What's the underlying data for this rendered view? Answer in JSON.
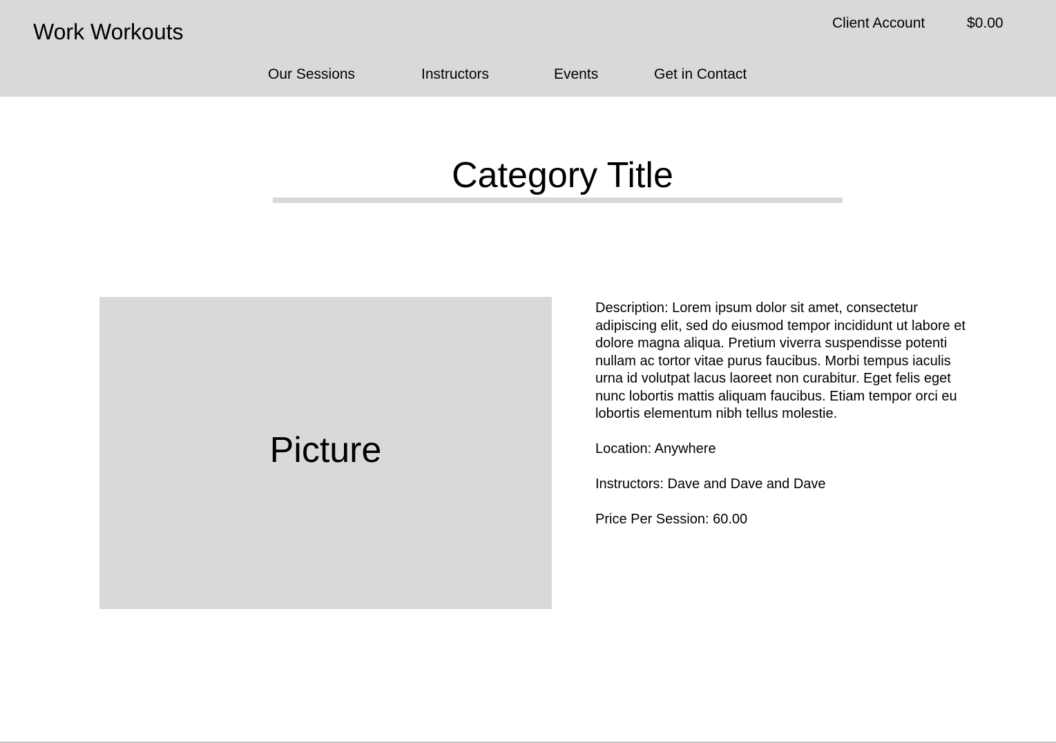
{
  "header": {
    "brand": "Work Workouts",
    "account_label": "Client Account",
    "cart_total": "$0.00",
    "nav": [
      {
        "label": "Our Sessions"
      },
      {
        "label": "Instructors"
      },
      {
        "label": "Events"
      },
      {
        "label": "Get in Contact"
      }
    ]
  },
  "main": {
    "title": "Category Title",
    "picture_label": "Picture",
    "description": "Description: Lorem ipsum dolor sit amet, consectetur\nadipiscing elit, sed do eiusmod tempor incididunt ut labore et\ndolore magna aliqua. Pretium viverra suspendisse potenti\nnullam ac tortor vitae purus faucibus. Morbi tempus iaculis\nurna id volutpat lacus laoreet non curabitur. Eget felis eget\nnunc lobortis mattis aliquam faucibus. Etiam tempor orci eu\nlobortis elementum nibh tellus molestie.",
    "location": "Location: Anywhere",
    "instructors": "Instructors: Dave and Dave and Dave",
    "price": "Price Per Session: 60.00"
  },
  "colors": {
    "header_bg": "#d9d9d9",
    "placeholder_bg": "#d9d9d9",
    "text": "#000000"
  }
}
